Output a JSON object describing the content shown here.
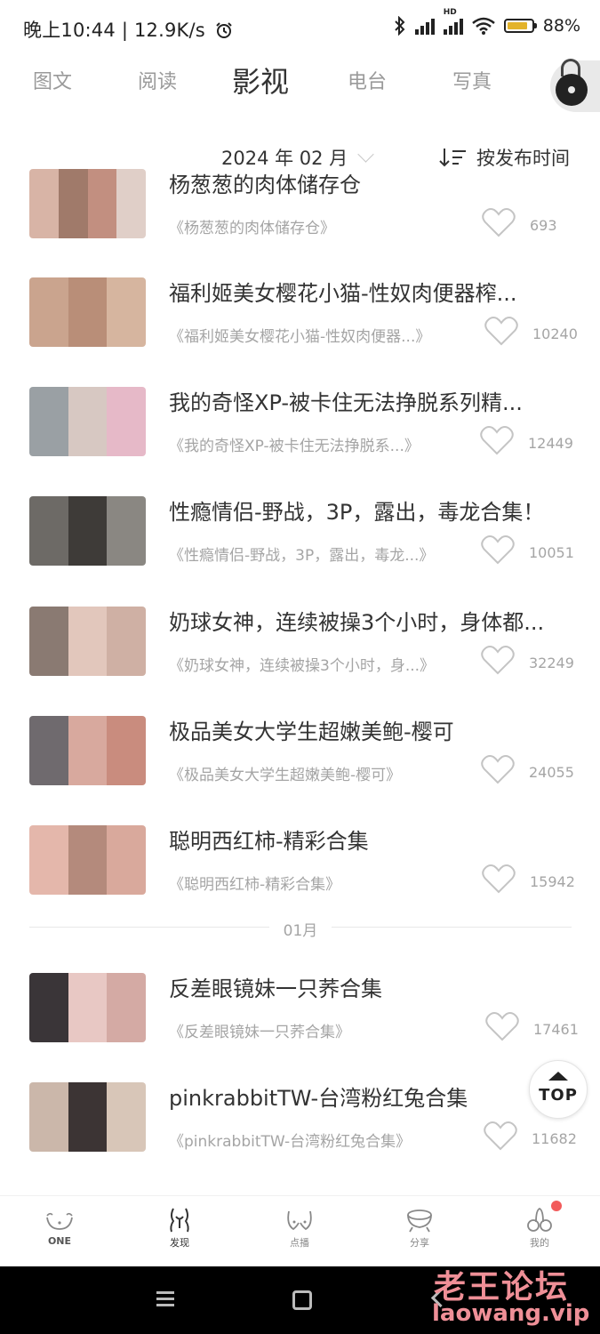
{
  "status_bar": {
    "time": "晚上10:44",
    "net_speed": "12.9K/s",
    "hd_label": "HD",
    "battery": "88%",
    "battery_level": 0.88
  },
  "tabs": [
    {
      "label": "图文",
      "active": false
    },
    {
      "label": "阅读",
      "active": false
    },
    {
      "label": "影视",
      "active": true
    },
    {
      "label": "电台",
      "active": false
    },
    {
      "label": "写真",
      "active": false
    }
  ],
  "filter": {
    "date": "2024 年 02 月",
    "sort": "按发布时间"
  },
  "items": [
    {
      "title": "杨葱葱的肉体储存仓",
      "subtitle": "《杨葱葱的肉体储存仓》",
      "count": "693",
      "thumb_colors": [
        "#d8b4a6",
        "#a07a6a",
        "#c28f80",
        "#e0cfc8"
      ]
    },
    {
      "title": "福利姬美女樱花小猫-性奴肉便器榨...",
      "subtitle": "《福利姬美女樱花小猫-性奴肉便器...》",
      "count": "10240",
      "thumb_colors": [
        "#caa48e",
        "#b98e78",
        "#d6b59f"
      ]
    },
    {
      "title": "我的奇怪XP-被卡住无法挣脱系列精...",
      "subtitle": "《我的奇怪XP-被卡住无法挣脱系...》",
      "count": "12449",
      "thumb_colors": [
        "#9aa0a4",
        "#d7c8c2",
        "#e6b9c8"
      ]
    },
    {
      "title": "性瘾情侣-野战，3P，露出，毒龙合集！",
      "subtitle": "《性瘾情侣-野战，3P，露出，毒龙...》",
      "count": "10051",
      "thumb_colors": [
        "#6d6a66",
        "#3e3b38",
        "#8a8782"
      ]
    },
    {
      "title": "奶球女神，连续被操3个小时，身体都...",
      "subtitle": "《奶球女神，连续被操3个小时，身...》",
      "count": "32249",
      "thumb_colors": [
        "#8a7a72",
        "#e2c7bc",
        "#cfb0a4"
      ]
    },
    {
      "title": "极品美女大学生超嫩美鲍-樱可",
      "subtitle": "《极品美女大学生超嫩美鲍-樱可》",
      "count": "24055",
      "thumb_colors": [
        "#6f6a6e",
        "#d8a99e",
        "#c98c7e"
      ]
    },
    {
      "title": "聪明西红柿-精彩合集",
      "subtitle": "《聪明西红柿-精彩合集》",
      "count": "15942",
      "thumb_colors": [
        "#e4b7ab",
        "#b48a7c",
        "#d9a99c"
      ]
    },
    {
      "title": "反差眼镜妹一只荞合集",
      "subtitle": "《反差眼镜妹一只荞合集》",
      "count": "17461",
      "thumb_colors": [
        "#3a3538",
        "#e8c8c4",
        "#d4aaa4"
      ]
    },
    {
      "title": "pinkrabbitTW-台湾粉红兔合集",
      "subtitle": "《pinkrabbitTW-台湾粉红兔合集》",
      "count": "11682",
      "thumb_colors": [
        "#cbb7aa",
        "#3c3434",
        "#d8c6b8"
      ]
    }
  ],
  "month_divider": "01月",
  "top_button": "TOP",
  "bottom_nav": [
    {
      "label": "ONE",
      "icon": "one-icon"
    },
    {
      "label": "发现",
      "icon": "discover-icon"
    },
    {
      "label": "点播",
      "icon": "vod-icon"
    },
    {
      "label": "分享",
      "icon": "share-icon"
    },
    {
      "label": "我的",
      "icon": "profile-icon"
    }
  ],
  "watermark": {
    "line1": "老王论坛",
    "line2": "laowang.vip"
  }
}
